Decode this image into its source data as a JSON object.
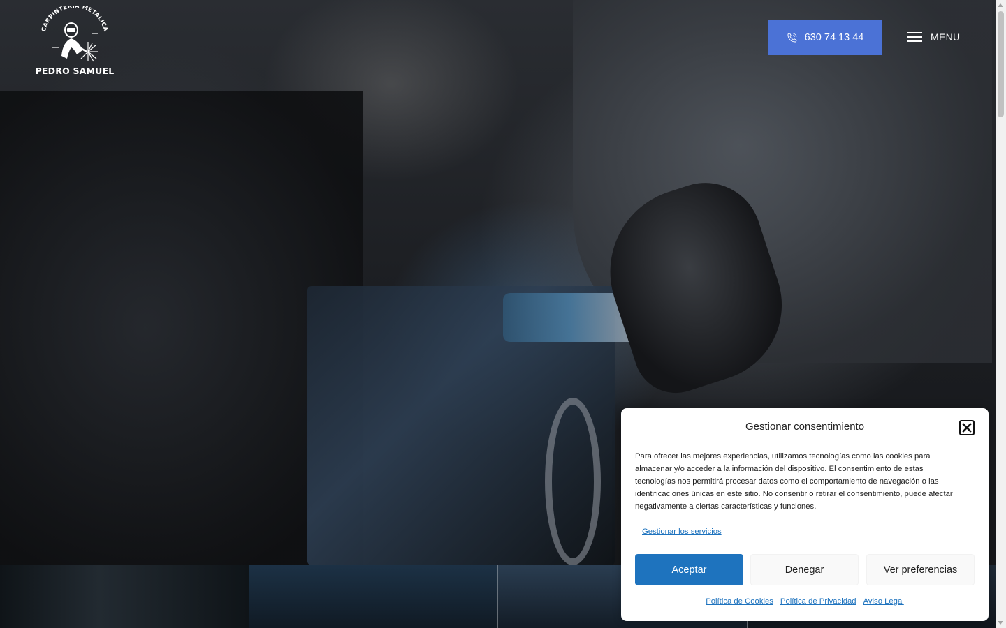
{
  "brand": {
    "arc_text": "CARPINTERÍA METÁLICA",
    "name": "PEDRO SAMUEL"
  },
  "header": {
    "phone": "630 74 13 44",
    "menu_label": "MENU",
    "accent_color": "#4b72d6"
  },
  "icons": {
    "phone": "phone-icon",
    "menu": "hamburger-icon",
    "close": "close-icon",
    "logo": "welder-icon"
  },
  "consent": {
    "title": "Gestionar consentimiento",
    "body": "Para ofrecer las mejores experiencias, utilizamos tecnologías como las cookies para almacenar y/o acceder a la información del dispositivo. El consentimiento de estas tecnologías nos permitirá procesar datos como el comportamiento de navegación o las identificaciones únicas en este sitio. No consentir o retirar el consentimiento, puede afectar negativamente a ciertas características y funciones.",
    "manage_services": "Gestionar los servicios",
    "accept_label": "Aceptar",
    "deny_label": "Denegar",
    "preferences_label": "Ver preferencias",
    "links": [
      "Política de Cookies",
      "Política de Privacidad",
      "Aviso Legal"
    ],
    "accent_color": "#1e73be"
  }
}
